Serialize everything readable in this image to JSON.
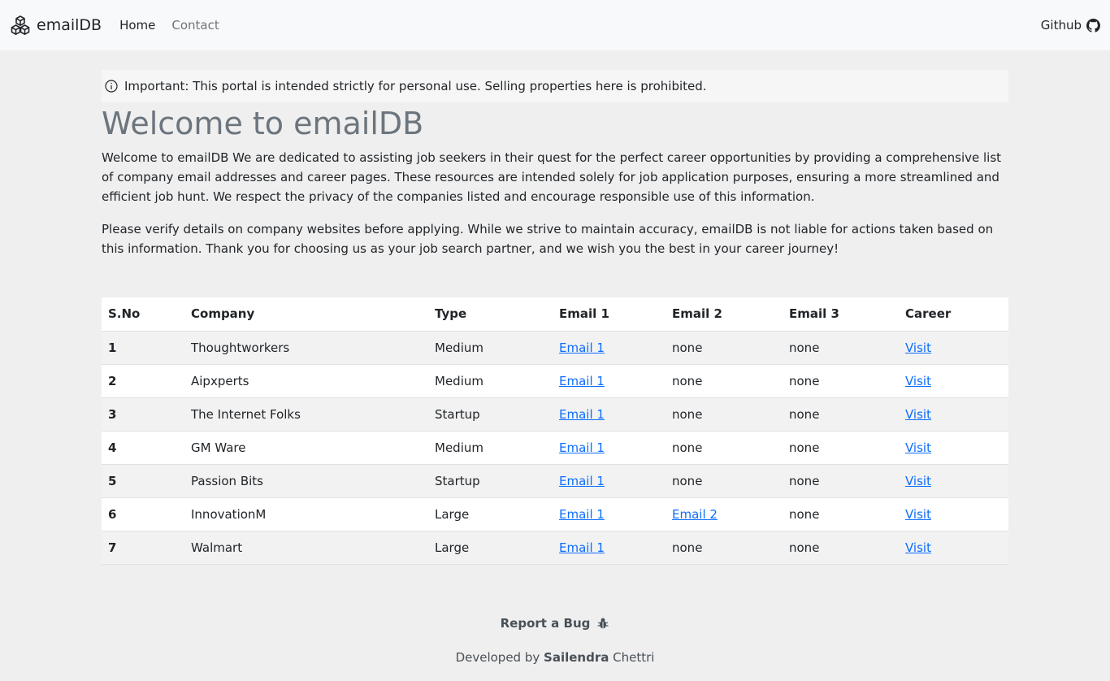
{
  "navbar": {
    "brand": "emailDB",
    "brand_icon": "cubes-icon",
    "links": [
      {
        "label": "Home"
      },
      {
        "label": "Contact"
      }
    ],
    "github_label": "Github",
    "github_icon": "github-icon"
  },
  "alert": {
    "icon": "info-circle-icon",
    "text": "Important: This portal is intended strictly for personal use. Selling properties here is prohibited."
  },
  "main": {
    "title": "Welcome to emailDB",
    "paragraph1": "Welcome to emailDB We are dedicated to assisting job seekers in their quest for the perfect career opportunities by providing a comprehensive list of company email addresses and career pages. These resources are intended solely for job application purposes, ensuring a more streamlined and efficient job hunt. We respect the privacy of the companies listed and encourage responsible use of this information.",
    "paragraph2": "Please verify details on company websites before applying. While we strive to maintain accuracy, emailDB is not liable for actions taken based on this information. Thank you for choosing us as your job search partner, and we wish you the best in your career journey!"
  },
  "table": {
    "headers": [
      "S.No",
      "Company",
      "Type",
      "Email 1",
      "Email 2",
      "Email 3",
      "Career"
    ],
    "rows": [
      {
        "sno": "1",
        "company": "Thoughtworkers",
        "type": "Medium",
        "email1": "Email 1",
        "email2": "none",
        "email3": "none",
        "career": "Visit"
      },
      {
        "sno": "2",
        "company": "Aipxperts",
        "type": "Medium",
        "email1": "Email 1",
        "email2": "none",
        "email3": "none",
        "career": "Visit"
      },
      {
        "sno": "3",
        "company": "The Internet Folks",
        "type": "Startup",
        "email1": "Email 1",
        "email2": "none",
        "email3": "none",
        "career": "Visit"
      },
      {
        "sno": "4",
        "company": "GM Ware",
        "type": "Medium",
        "email1": "Email 1",
        "email2": "none",
        "email3": "none",
        "career": "Visit"
      },
      {
        "sno": "5",
        "company": "Passion Bits",
        "type": "Startup",
        "email1": "Email 1",
        "email2": "none",
        "email3": "none",
        "career": "Visit"
      },
      {
        "sno": "6",
        "company": "InnovationM",
        "type": "Large",
        "email1": "Email 1",
        "email2": "Email 2",
        "email3": "none",
        "career": "Visit"
      },
      {
        "sno": "7",
        "company": "Walmart",
        "type": "Large",
        "email1": "Email 1",
        "email2": "none",
        "email3": "none",
        "career": "Visit"
      }
    ]
  },
  "footer": {
    "report_label": "Report a Bug",
    "report_icon": "bug-icon",
    "dev_prefix": "Developed by",
    "dev_first": "Sailendra",
    "dev_last": "Chettri"
  },
  "colors": {
    "link": "#0d6efd",
    "title": "#6c757d",
    "background": "#efefef"
  }
}
